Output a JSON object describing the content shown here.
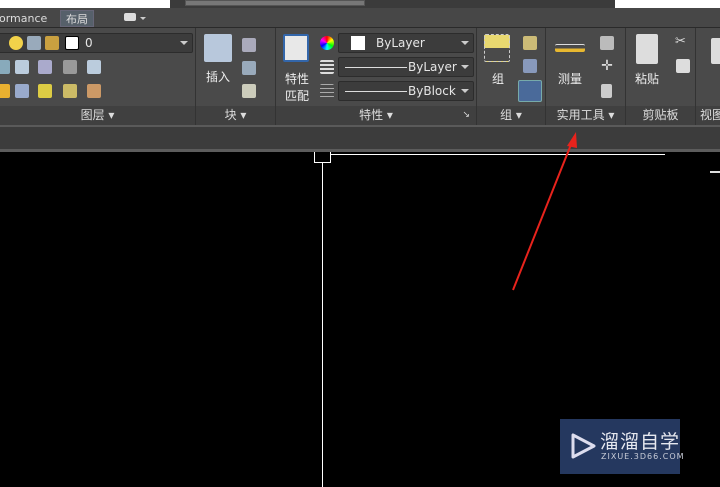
{
  "tabs": {
    "performance": "ormance",
    "layout": "布局"
  },
  "layers": {
    "current_layer": "0",
    "label": "图层"
  },
  "block": {
    "insert": "插入",
    "label": "块"
  },
  "properties": {
    "match_line1": "特性",
    "match_line2": "匹配",
    "color": "ByLayer",
    "linetype": "ByLayer",
    "lineweight": "ByBlock",
    "label": "特性"
  },
  "group": {
    "group": "组",
    "label": "组"
  },
  "utilities": {
    "measure": "测量",
    "label": "实用工具"
  },
  "clipboard": {
    "paste": "粘贴",
    "label": "剪贴板"
  },
  "view": {
    "label": "视图"
  },
  "watermark": {
    "name": "溜溜自学",
    "url": "ZIXUE.3D66.COM"
  },
  "colors": {
    "arrow": "#e8231c",
    "ribbon": "#4a4a4a",
    "watermark_bg": "#25385f"
  }
}
